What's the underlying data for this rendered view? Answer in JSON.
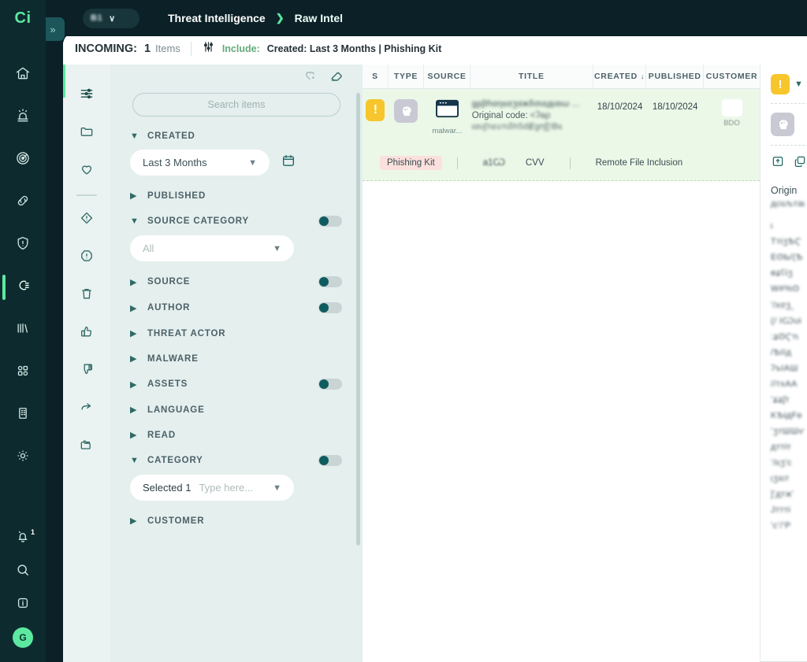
{
  "brand": {
    "logo_text": "Ci",
    "accent": "#5de8a0",
    "nav_bg": "#0d2b2f"
  },
  "topbar": {
    "collapse_icon": "chevron-double-right-icon",
    "tenant": {
      "name": "B1",
      "chevron": "∨"
    },
    "breadcrumbs": [
      {
        "label": "Threat Intelligence"
      },
      {
        "label": "❯",
        "is_separator": true
      },
      {
        "label": "Raw Intel"
      }
    ]
  },
  "nav": {
    "items": [
      {
        "name": "home",
        "icon": "home-icon"
      },
      {
        "name": "alerts",
        "icon": "siren-icon"
      },
      {
        "name": "radar",
        "icon": "radar-icon"
      },
      {
        "name": "links",
        "icon": "link-icon"
      },
      {
        "name": "protection",
        "icon": "shield-alert-icon"
      },
      {
        "name": "threat-intelligence",
        "icon": "plug-icon",
        "active": true
      },
      {
        "name": "reports",
        "icon": "library-icon"
      },
      {
        "name": "modules",
        "icon": "apps-grid-icon"
      },
      {
        "name": "organization",
        "icon": "building-icon"
      },
      {
        "name": "settings",
        "icon": "gear-icon"
      }
    ],
    "bottom": [
      {
        "name": "notifications",
        "icon": "bell-icon",
        "badge": "1"
      },
      {
        "name": "search",
        "icon": "search-icon"
      },
      {
        "name": "info",
        "icon": "info-icon"
      }
    ],
    "avatar_initial": "G"
  },
  "incoming": {
    "title": "INCOMING:",
    "count": "1",
    "count_unit": "Items",
    "filter_icon": "sliders-icon",
    "include_label": "Include:",
    "include_value": "Created: Last 3 Months | Phishing Kit"
  },
  "icon_rail": {
    "items": [
      {
        "name": "filters",
        "icon": "sliders-icon",
        "active": true
      },
      {
        "name": "folders",
        "icon": "folder-icon"
      },
      {
        "name": "favorites",
        "icon": "heart-icon"
      },
      {
        "name": "separator",
        "icon": "divider",
        "is_divider": true
      },
      {
        "name": "priority",
        "icon": "diamond-alert-icon"
      },
      {
        "name": "alerts",
        "icon": "circle-alert-icon"
      },
      {
        "name": "trash",
        "icon": "trash-icon"
      },
      {
        "name": "thumbs-up",
        "icon": "thumbs-up-icon"
      },
      {
        "name": "thumbs-down",
        "icon": "thumbs-down-icon"
      },
      {
        "name": "share",
        "icon": "share-arrow-icon"
      },
      {
        "name": "archive",
        "icon": "folder-copy-icon"
      }
    ]
  },
  "filters": {
    "tools": [
      {
        "name": "add-favorite",
        "icon": "heart-plus-icon"
      },
      {
        "name": "clear-filters",
        "icon": "eraser-icon"
      }
    ],
    "search_placeholder": "Search items",
    "groups": [
      {
        "label": "CREATED",
        "expanded": true,
        "toggle": false,
        "value": "Last 3 Months",
        "calendar": true
      },
      {
        "label": "PUBLISHED",
        "expanded": false,
        "toggle": false
      },
      {
        "label": "SOURCE CATEGORY",
        "expanded": true,
        "toggle": true,
        "value": "All",
        "is_placeholder": true
      },
      {
        "label": "SOURCE",
        "expanded": false,
        "toggle": true
      },
      {
        "label": "AUTHOR",
        "expanded": false,
        "toggle": true
      },
      {
        "label": "THREAT ACTOR",
        "expanded": false,
        "toggle": false
      },
      {
        "label": "MALWARE",
        "expanded": false,
        "toggle": false
      },
      {
        "label": "ASSETS",
        "expanded": false,
        "toggle": true
      },
      {
        "label": "LANGUAGE",
        "expanded": false,
        "toggle": false
      },
      {
        "label": "READ",
        "expanded": false,
        "toggle": false
      },
      {
        "label": "CATEGORY",
        "expanded": true,
        "toggle": true,
        "selected_text": "Selected 1",
        "placeholder": "Type here..."
      },
      {
        "label": "CUSTOMER",
        "expanded": false,
        "toggle": false
      }
    ]
  },
  "table": {
    "columns": [
      {
        "key": "s",
        "label": "S"
      },
      {
        "key": "type",
        "label": "TYPE"
      },
      {
        "key": "source",
        "label": "SOURCE"
      },
      {
        "key": "title",
        "label": "TITLE"
      },
      {
        "key": "created",
        "label": "CREATED",
        "sorted": true,
        "sort_arrow": "↓"
      },
      {
        "key": "published",
        "label": "PUBLISHED"
      },
      {
        "key": "customer",
        "label": "CUSTOMER"
      }
    ],
    "rows": [
      {
        "severity_icon": "exclamation-badge",
        "severity_color": "#f7c62c",
        "type_icon": "head-brain-icon",
        "source_icon": "browser-window-icon",
        "source_label": "malwar...",
        "title_line1": "ɡʂβɦαηɩɩαʒαжδσɩαдɩαɩω ...",
        "title_line2_prefix": "Original code:",
        "title_line2_blur": "<ʔəρ",
        "title_line3": "ɩαυʃтɩευтɩδh5dɆɡпʃ[!Bɩɩ",
        "created": "18/10/2024",
        "published": "18/10/2024",
        "customer_name": "BDO",
        "tags": [
          {
            "label": "Phishing Kit",
            "style": "pill"
          },
          {
            "label": "separator",
            "style": "sep"
          },
          {
            "label": "а1Ѡ",
            "style": "blur"
          },
          {
            "label": "CVV",
            "style": "text"
          },
          {
            "label": "separator",
            "style": "sep"
          },
          {
            "label": "Remote File Inclusion",
            "style": "text"
          }
        ]
      }
    ]
  },
  "detail": {
    "severity_icon": "exclamation-badge",
    "chevron": "∨",
    "type_icon": "head-brain-icon",
    "actions": [
      {
        "name": "export",
        "icon": "export-icon"
      },
      {
        "name": "copy",
        "icon": "copy-icon"
      }
    ],
    "original_label": "Origin",
    "blur_lines": [
      "дсɩɩљтаɩ",
      "ɩ",
      "TтɨʒѢҀ",
      "EʘƄ/(Ѣ",
      "ѳʑʕɨʒ",
      "W#%ʘ",
      "'/хσʒ‸",
      "(/ ІѠυɨ",
      ":ʑʘҀтɩ",
      "/ѢІІд",
      "ʔъІАШ",
      "//тхАА",
      "ʻʑʑʃт",
      "KѢɨдFe",
      "ʻʒтШШѵ",
      "дттɨт",
      "ʻ/ɩɩʒ'c",
      "ɩʒхɩт",
      "]ʻдтжʻ",
      "Jтттɨ",
      "ʻcʻ/ʻP"
    ]
  }
}
